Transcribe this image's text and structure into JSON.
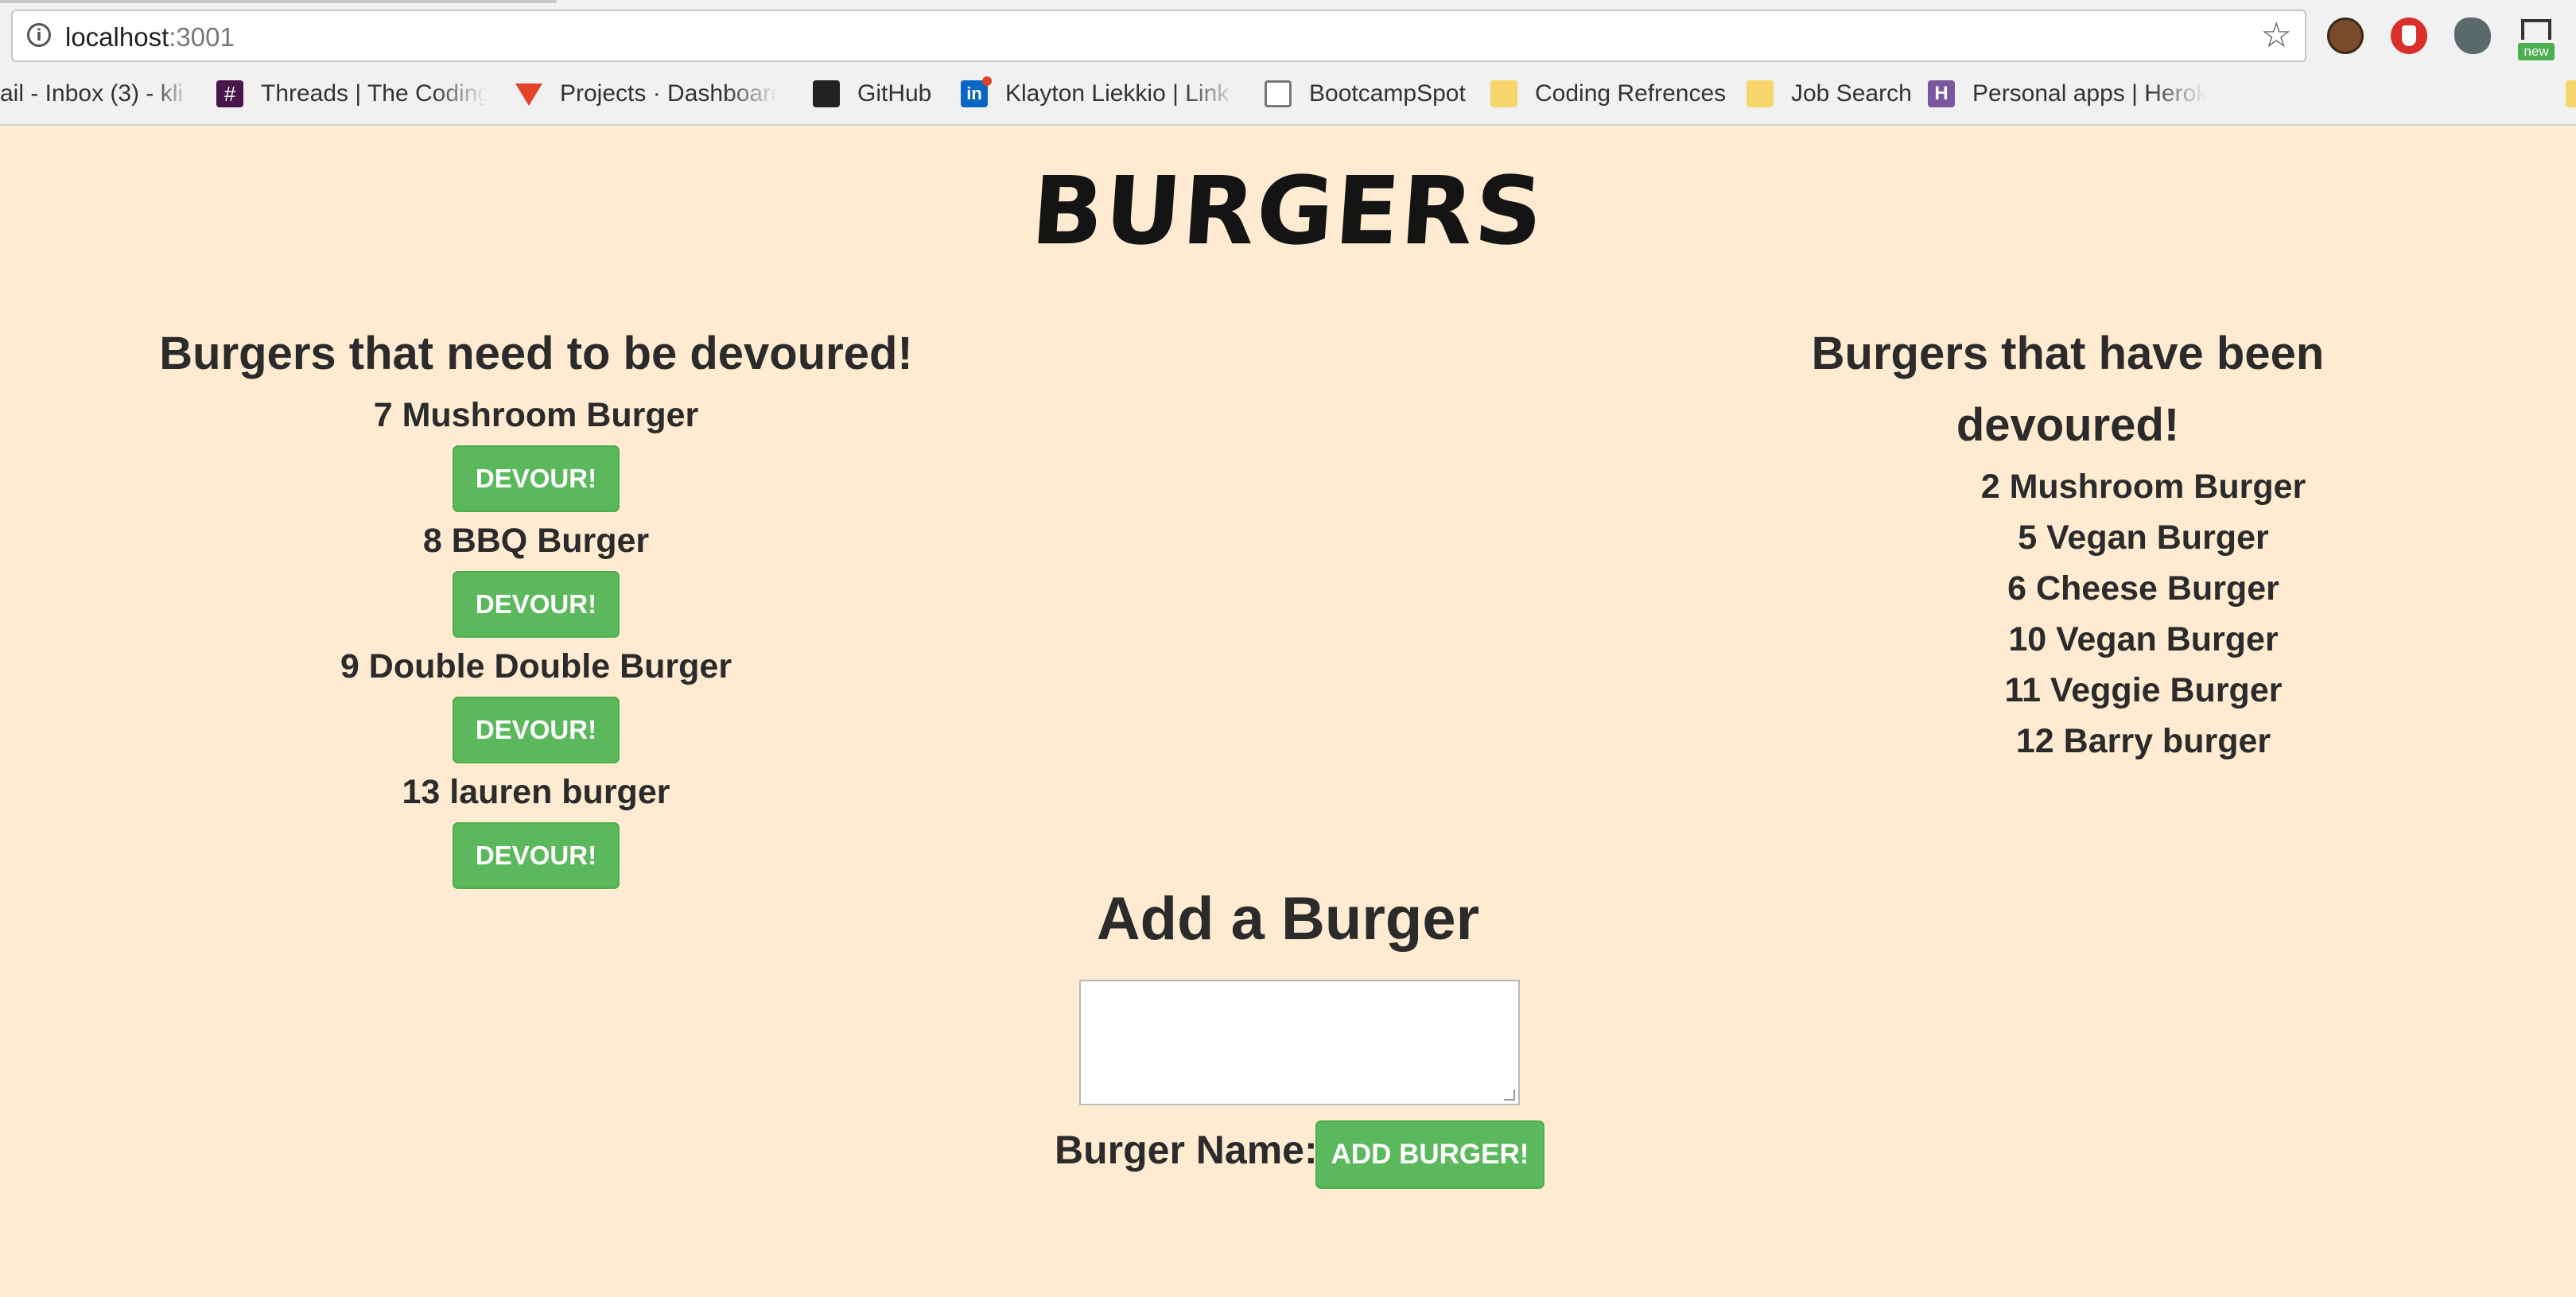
{
  "browser": {
    "url_host": "localhost",
    "url_port": ":3001",
    "bookmarks": [
      {
        "label": "ail - Inbox (3) - kli",
        "icon": "gmail-icon"
      },
      {
        "label": "Threads | The Coding",
        "icon": "slack-icon"
      },
      {
        "label": "Projects · Dashboard",
        "icon": "gitlab-icon"
      },
      {
        "label": "GitHub",
        "icon": "github-icon"
      },
      {
        "label": "Klayton Liekkio | Link",
        "icon": "linkedin-icon"
      },
      {
        "label": "BootcampSpot",
        "icon": "page-icon"
      },
      {
        "label": "Coding Refrences",
        "icon": "folder-icon"
      },
      {
        "label": "Job Search",
        "icon": "folder-icon"
      },
      {
        "label": "Personal apps | Herok",
        "icon": "heroku-icon"
      }
    ],
    "extension_badge": "new"
  },
  "page": {
    "logo": "BURGERS",
    "left": {
      "heading": "Burgers that need to be devoured!",
      "items": [
        {
          "name": "7 Mushroom Burger",
          "button": "DEVOUR!"
        },
        {
          "name": "8 BBQ Burger",
          "button": "DEVOUR!"
        },
        {
          "name": "9 Double Double Burger",
          "button": "DEVOUR!"
        },
        {
          "name": "13 lauren burger",
          "button": "DEVOUR!"
        }
      ]
    },
    "right": {
      "heading": "Burgers that have been devoured!",
      "items": [
        "2 Mushroom Burger",
        "5 Vegan Burger",
        "6 Cheese Burger",
        "10 Vegan Burger",
        "11 Veggie Burger",
        "12 Barry burger"
      ]
    },
    "add": {
      "heading": "Add a Burger",
      "input_value": "",
      "label": "Burger Name:",
      "button": "ADD BURGER!"
    }
  },
  "colors": {
    "background": "#ffebd1",
    "button": "#5cb85c"
  }
}
